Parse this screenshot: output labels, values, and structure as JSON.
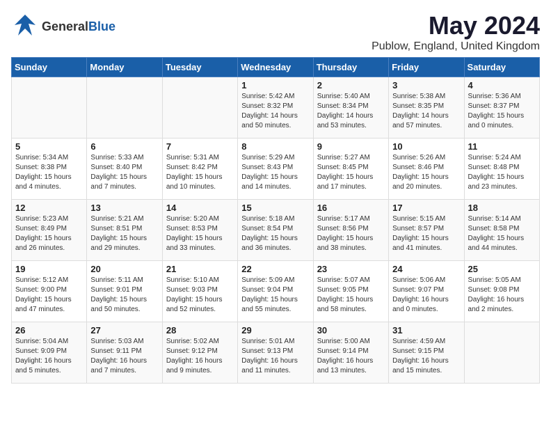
{
  "logo": {
    "general": "General",
    "blue": "Blue"
  },
  "title": "May 2024",
  "location": "Publow, England, United Kingdom",
  "days_header": [
    "Sunday",
    "Monday",
    "Tuesday",
    "Wednesday",
    "Thursday",
    "Friday",
    "Saturday"
  ],
  "weeks": [
    [
      {
        "day": "",
        "info": ""
      },
      {
        "day": "",
        "info": ""
      },
      {
        "day": "",
        "info": ""
      },
      {
        "day": "1",
        "info": "Sunrise: 5:42 AM\nSunset: 8:32 PM\nDaylight: 14 hours\nand 50 minutes."
      },
      {
        "day": "2",
        "info": "Sunrise: 5:40 AM\nSunset: 8:34 PM\nDaylight: 14 hours\nand 53 minutes."
      },
      {
        "day": "3",
        "info": "Sunrise: 5:38 AM\nSunset: 8:35 PM\nDaylight: 14 hours\nand 57 minutes."
      },
      {
        "day": "4",
        "info": "Sunrise: 5:36 AM\nSunset: 8:37 PM\nDaylight: 15 hours\nand 0 minutes."
      }
    ],
    [
      {
        "day": "5",
        "info": "Sunrise: 5:34 AM\nSunset: 8:38 PM\nDaylight: 15 hours\nand 4 minutes."
      },
      {
        "day": "6",
        "info": "Sunrise: 5:33 AM\nSunset: 8:40 PM\nDaylight: 15 hours\nand 7 minutes."
      },
      {
        "day": "7",
        "info": "Sunrise: 5:31 AM\nSunset: 8:42 PM\nDaylight: 15 hours\nand 10 minutes."
      },
      {
        "day": "8",
        "info": "Sunrise: 5:29 AM\nSunset: 8:43 PM\nDaylight: 15 hours\nand 14 minutes."
      },
      {
        "day": "9",
        "info": "Sunrise: 5:27 AM\nSunset: 8:45 PM\nDaylight: 15 hours\nand 17 minutes."
      },
      {
        "day": "10",
        "info": "Sunrise: 5:26 AM\nSunset: 8:46 PM\nDaylight: 15 hours\nand 20 minutes."
      },
      {
        "day": "11",
        "info": "Sunrise: 5:24 AM\nSunset: 8:48 PM\nDaylight: 15 hours\nand 23 minutes."
      }
    ],
    [
      {
        "day": "12",
        "info": "Sunrise: 5:23 AM\nSunset: 8:49 PM\nDaylight: 15 hours\nand 26 minutes."
      },
      {
        "day": "13",
        "info": "Sunrise: 5:21 AM\nSunset: 8:51 PM\nDaylight: 15 hours\nand 29 minutes."
      },
      {
        "day": "14",
        "info": "Sunrise: 5:20 AM\nSunset: 8:53 PM\nDaylight: 15 hours\nand 33 minutes."
      },
      {
        "day": "15",
        "info": "Sunrise: 5:18 AM\nSunset: 8:54 PM\nDaylight: 15 hours\nand 36 minutes."
      },
      {
        "day": "16",
        "info": "Sunrise: 5:17 AM\nSunset: 8:56 PM\nDaylight: 15 hours\nand 38 minutes."
      },
      {
        "day": "17",
        "info": "Sunrise: 5:15 AM\nSunset: 8:57 PM\nDaylight: 15 hours\nand 41 minutes."
      },
      {
        "day": "18",
        "info": "Sunrise: 5:14 AM\nSunset: 8:58 PM\nDaylight: 15 hours\nand 44 minutes."
      }
    ],
    [
      {
        "day": "19",
        "info": "Sunrise: 5:12 AM\nSunset: 9:00 PM\nDaylight: 15 hours\nand 47 minutes."
      },
      {
        "day": "20",
        "info": "Sunrise: 5:11 AM\nSunset: 9:01 PM\nDaylight: 15 hours\nand 50 minutes."
      },
      {
        "day": "21",
        "info": "Sunrise: 5:10 AM\nSunset: 9:03 PM\nDaylight: 15 hours\nand 52 minutes."
      },
      {
        "day": "22",
        "info": "Sunrise: 5:09 AM\nSunset: 9:04 PM\nDaylight: 15 hours\nand 55 minutes."
      },
      {
        "day": "23",
        "info": "Sunrise: 5:07 AM\nSunset: 9:05 PM\nDaylight: 15 hours\nand 58 minutes."
      },
      {
        "day": "24",
        "info": "Sunrise: 5:06 AM\nSunset: 9:07 PM\nDaylight: 16 hours\nand 0 minutes."
      },
      {
        "day": "25",
        "info": "Sunrise: 5:05 AM\nSunset: 9:08 PM\nDaylight: 16 hours\nand 2 minutes."
      }
    ],
    [
      {
        "day": "26",
        "info": "Sunrise: 5:04 AM\nSunset: 9:09 PM\nDaylight: 16 hours\nand 5 minutes."
      },
      {
        "day": "27",
        "info": "Sunrise: 5:03 AM\nSunset: 9:11 PM\nDaylight: 16 hours\nand 7 minutes."
      },
      {
        "day": "28",
        "info": "Sunrise: 5:02 AM\nSunset: 9:12 PM\nDaylight: 16 hours\nand 9 minutes."
      },
      {
        "day": "29",
        "info": "Sunrise: 5:01 AM\nSunset: 9:13 PM\nDaylight: 16 hours\nand 11 minutes."
      },
      {
        "day": "30",
        "info": "Sunrise: 5:00 AM\nSunset: 9:14 PM\nDaylight: 16 hours\nand 13 minutes."
      },
      {
        "day": "31",
        "info": "Sunrise: 4:59 AM\nSunset: 9:15 PM\nDaylight: 16 hours\nand 15 minutes."
      },
      {
        "day": "",
        "info": ""
      }
    ]
  ]
}
